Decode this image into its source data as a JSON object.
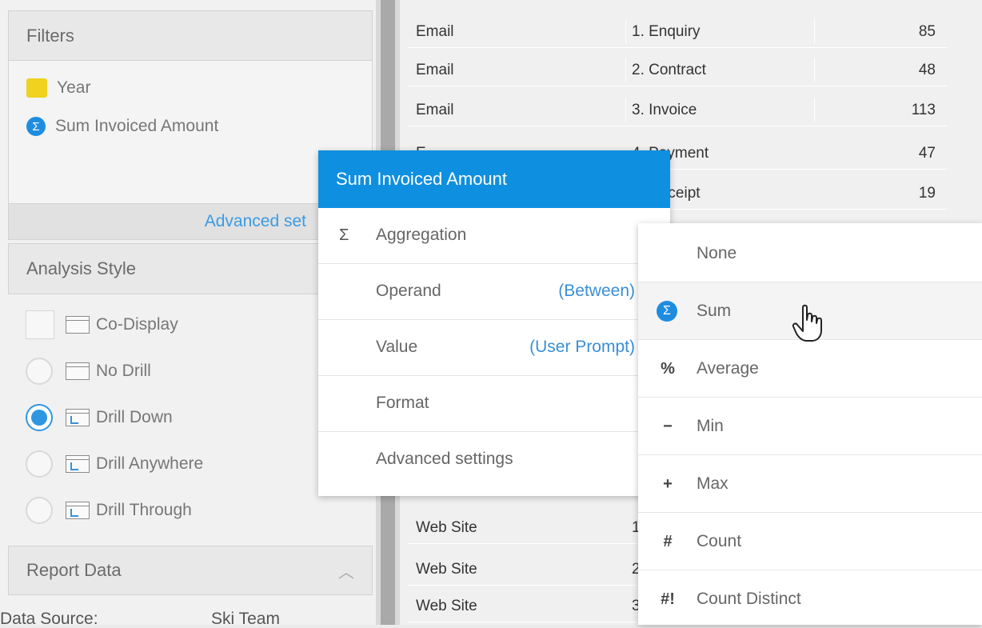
{
  "filters": {
    "title": "Filters",
    "items": [
      {
        "icon": "year-color-swatch-icon",
        "label": "Year"
      },
      {
        "icon": "sigma-icon",
        "label": "Sum Invoiced Amount"
      }
    ],
    "advanced_link": "Advanced set"
  },
  "analysis_style": {
    "title": "Analysis Style",
    "options": [
      {
        "control": "checkbox",
        "label": "Co-Display",
        "selected": false
      },
      {
        "control": "radio",
        "label": "No Drill",
        "selected": false
      },
      {
        "control": "radio",
        "label": "Drill Down",
        "selected": true
      },
      {
        "control": "radio",
        "label": "Drill Anywhere",
        "selected": false
      },
      {
        "control": "radio",
        "label": "Drill Through",
        "selected": false
      }
    ]
  },
  "report_data": {
    "title": "Report Data",
    "data_source_label": "Data Source:",
    "data_source_value": "Ski Team"
  },
  "table": {
    "rows": [
      {
        "channel": "Email",
        "stage": "1. Enquiry",
        "count": "85"
      },
      {
        "channel": "Email",
        "stage": "2. Contract",
        "count": "48"
      },
      {
        "channel": "Email",
        "stage": "3. Invoice",
        "count": "113"
      },
      {
        "channel": "E",
        "stage": "4. Payment",
        "count": "47"
      },
      {
        "channel": "E",
        "stage": "5. Receipt",
        "count": "19"
      },
      {
        "channel": "Web Site",
        "stage": "1",
        "count": ""
      },
      {
        "channel": "Web Site",
        "stage": "2",
        "count": ""
      },
      {
        "channel": "Web Site",
        "stage": "3",
        "count": ""
      }
    ]
  },
  "popup": {
    "title": "Sum Invoiced Amount",
    "items": [
      {
        "icon": "Σ",
        "label": "Aggregation",
        "value": ""
      },
      {
        "icon": "",
        "label": "Operand",
        "value": "(Between)"
      },
      {
        "icon": "",
        "label": "Value",
        "value": "(User Prompt)"
      },
      {
        "icon": "",
        "label": "Format",
        "value": ""
      },
      {
        "icon": "",
        "label": "Advanced settings",
        "value": ""
      }
    ]
  },
  "submenu": {
    "items": [
      {
        "icon": "",
        "label": "None"
      },
      {
        "icon": "Σ",
        "label": "Sum"
      },
      {
        "icon": "%",
        "label": "Average"
      },
      {
        "icon": "−",
        "label": "Min"
      },
      {
        "icon": "+",
        "label": "Max"
      },
      {
        "icon": "#",
        "label": "Count"
      },
      {
        "icon": "#!",
        "label": "Count Distinct"
      }
    ],
    "hovered": "Sum"
  },
  "colors": {
    "accent": "#0f8fe0",
    "link": "#3a9be4",
    "year_swatch": "#f0d21f"
  }
}
